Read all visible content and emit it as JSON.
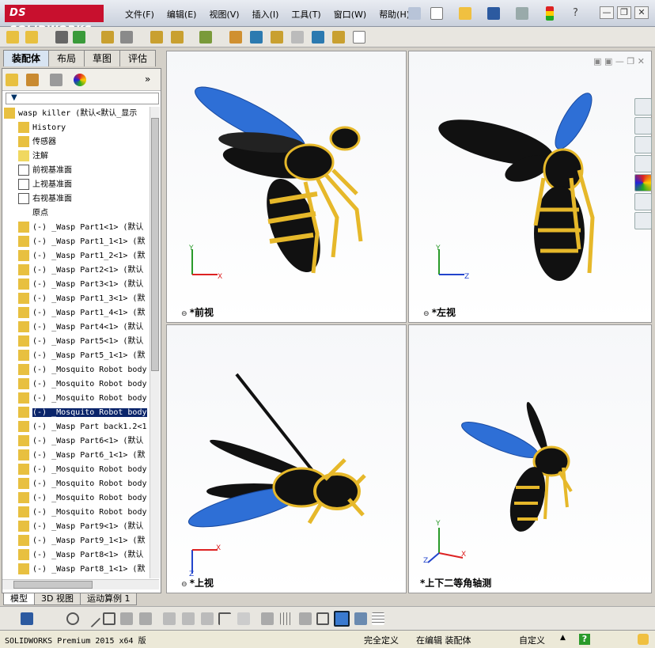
{
  "app": {
    "logo": "DS SOLIDWORKS"
  },
  "menu": [
    "文件(F)",
    "编辑(E)",
    "视图(V)",
    "插入(I)",
    "工具(T)",
    "窗口(W)",
    "帮助(H)"
  ],
  "window_controls": {
    "help": "?",
    "minimize": "—",
    "restore": "❐",
    "close": "✕"
  },
  "feature_tabs": [
    "装配体",
    "布局",
    "草图",
    "评估"
  ],
  "filter_icon": "funnel-icon",
  "tree": {
    "root": "wasp killer  (默认<默认_显示",
    "items": [
      {
        "label": "History",
        "icon": "history-icon"
      },
      {
        "label": "传感器",
        "icon": "sensor-icon"
      },
      {
        "label": "注解",
        "icon": "annotation-icon"
      },
      {
        "label": "前视基准面",
        "icon": "plane-icon"
      },
      {
        "label": "上视基准面",
        "icon": "plane-icon"
      },
      {
        "label": "右视基准面",
        "icon": "plane-icon"
      },
      {
        "label": "原点",
        "icon": "origin-icon"
      },
      {
        "label": "(-) _Wasp Part1<1> (默认",
        "icon": "part-icon"
      },
      {
        "label": "(-) _Wasp Part1_1<1> (默",
        "icon": "part-icon"
      },
      {
        "label": "(-) _Wasp Part1_2<1> (默",
        "icon": "part-icon"
      },
      {
        "label": "(-) _Wasp Part2<1> (默认",
        "icon": "part-icon"
      },
      {
        "label": "(-) _Wasp Part3<1> (默认",
        "icon": "part-icon"
      },
      {
        "label": "(-) _Wasp Part1_3<1> (默",
        "icon": "part-icon"
      },
      {
        "label": "(-) _Wasp Part1_4<1> (默",
        "icon": "part-icon"
      },
      {
        "label": "(-) _Wasp Part4<1> (默认",
        "icon": "part-icon"
      },
      {
        "label": "(-) _Wasp Part5<1> (默认",
        "icon": "part-icon"
      },
      {
        "label": "(-) _Wasp Part5_1<1> (默",
        "icon": "part-icon"
      },
      {
        "label": "(-) _Mosquito Robot body",
        "icon": "part-icon"
      },
      {
        "label": "(-) _Mosquito Robot body",
        "icon": "part-icon"
      },
      {
        "label": "(-) _Mosquito Robot body",
        "icon": "part-icon"
      },
      {
        "label": "(-) _Mosquito Robot body",
        "icon": "part-icon",
        "selected": true
      },
      {
        "label": "(-) _Wasp Part back1.2<1",
        "icon": "part-icon"
      },
      {
        "label": "(-) _Wasp Part6<1> (默认",
        "icon": "part-icon"
      },
      {
        "label": "(-) _Wasp Part6_1<1> (默",
        "icon": "part-icon"
      },
      {
        "label": "(-) _Mosquito Robot body",
        "icon": "part-icon"
      },
      {
        "label": "(-) _Mosquito Robot body",
        "icon": "part-icon"
      },
      {
        "label": "(-) _Mosquito Robot body",
        "icon": "part-icon"
      },
      {
        "label": "(-) _Mosquito Robot body",
        "icon": "part-icon"
      },
      {
        "label": "(-) _Wasp Part9<1> (默认",
        "icon": "part-icon"
      },
      {
        "label": "(-) _Wasp Part9_1<1> (默",
        "icon": "part-icon"
      },
      {
        "label": "(-) _Wasp Part8<1> (默认",
        "icon": "part-icon"
      },
      {
        "label": "(-) _Wasp Part8_1<1> (默",
        "icon": "part-icon"
      }
    ]
  },
  "viewports": {
    "front": {
      "label": "*前视",
      "axes": [
        "Y",
        "X"
      ]
    },
    "left": {
      "label": "*左视",
      "axes": [
        "Y",
        "Z"
      ]
    },
    "top": {
      "label": "*上视",
      "axes": [
        "X",
        "Z"
      ]
    },
    "iso": {
      "label": "*上下二等角轴测",
      "axes": [
        "Y",
        "X",
        "Z"
      ]
    }
  },
  "bottom_tabs": [
    "模型",
    "3D 视图",
    "运动算例 1"
  ],
  "status": {
    "product": "SOLIDWORKS Premium 2015 x64 版",
    "state": "完全定义",
    "editing": "在编辑 装配体",
    "units": "自定义",
    "arrow": "▲",
    "help": "?"
  },
  "colors": {
    "wing_blue": "#2e6fd6",
    "wasp_yellow": "#e6b82a",
    "wasp_black": "#111111",
    "selection": "#0a246a",
    "logo_red": "#c8102e"
  }
}
